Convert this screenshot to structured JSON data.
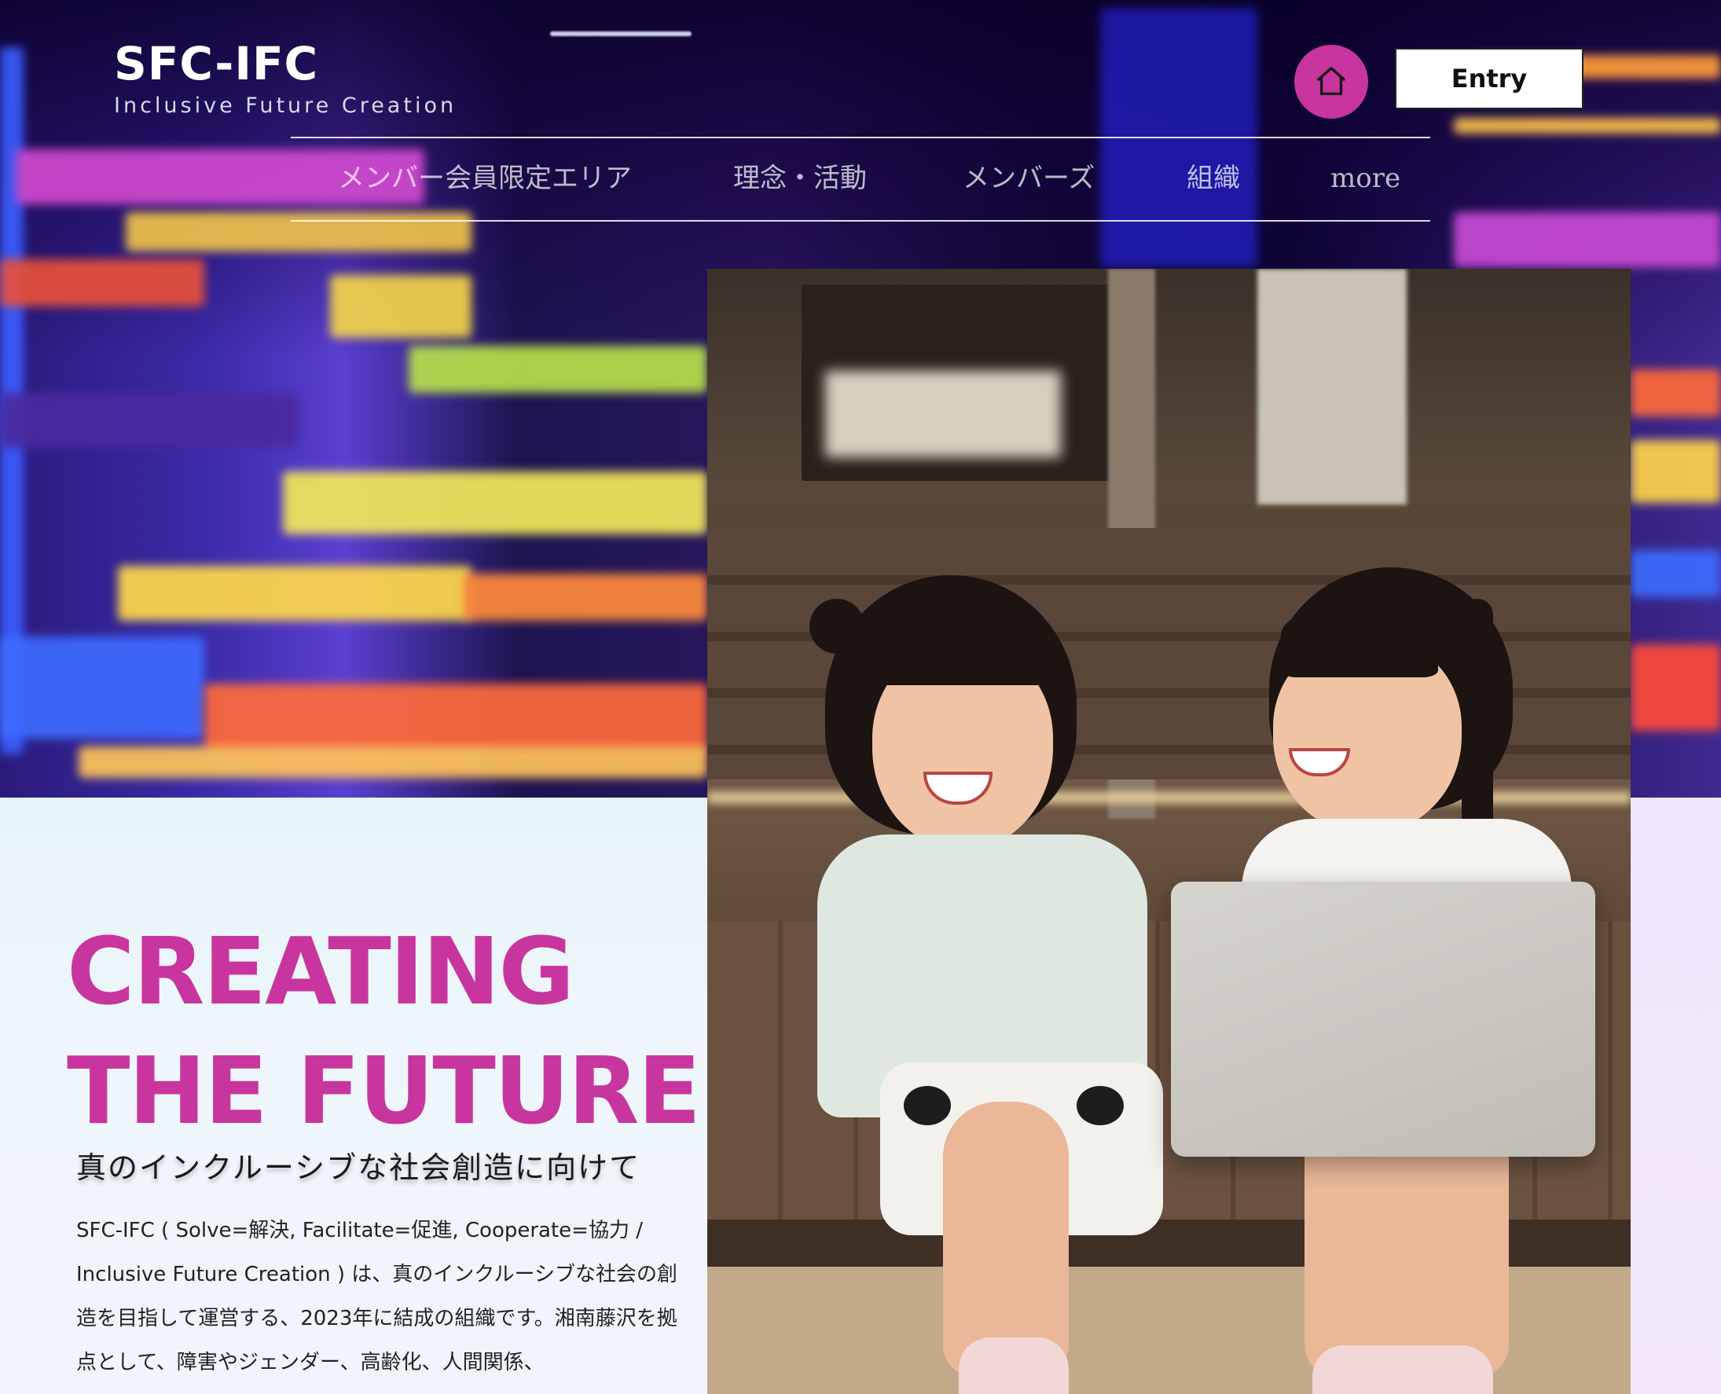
{
  "header": {
    "logo_title": "SFC-IFC",
    "logo_subtitle": "Inclusive Future Creation",
    "home_icon": "home-icon",
    "entry_label": "Entry"
  },
  "nav": {
    "items": [
      {
        "label": "メンバー会員限定エリア"
      },
      {
        "label": "理念・活動"
      },
      {
        "label": "メンバーズ"
      },
      {
        "label": "組織"
      },
      {
        "label": "more"
      }
    ]
  },
  "hero": {
    "headline_line1": "CREATING",
    "headline_line2": "THE FUTURE",
    "subheading": "真のインクルーシブな社会創造に向けて",
    "description": "SFC-IFC ( Solve=解決, Facilitate=促進, Cooperate=協力 / Inclusive Future Creation ) は、真のインクルーシブな社会の創造を目指して運営する、2023年に結成の組織です。湘南藤沢を拠点として、障害やジェンダー、高齢化、人間関係、"
  },
  "colors": {
    "accent": "#c8359f",
    "entry_button_bg": "#ffffff",
    "left_panel_bg": "#e6f3f8",
    "right_panel_bg": "#efe6fb"
  }
}
